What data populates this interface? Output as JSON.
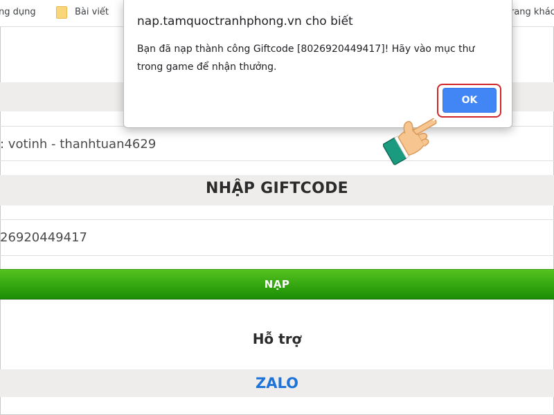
{
  "bookmarks": {
    "items": [
      {
        "label": "ng dụng"
      },
      {
        "label": "Bài viết"
      },
      {
        "label": "rang khác"
      }
    ]
  },
  "page": {
    "user_line": ": votinh - thanhtuan4629",
    "section_title": "NHẬP GIFTCODE",
    "code_value": "26920449417",
    "nap_button": "NẠP",
    "support_label": "Hỗ trợ",
    "zalo_link": "ZALO"
  },
  "dialog": {
    "title": "nap.tamquoctranhphong.vn cho biết",
    "message": "Bạn đã nạp thành công Giftcode [8026920449417]! Hãy vào mục thư trong game để nhận thưởng.",
    "ok_label": "OK"
  },
  "colors": {
    "ok_button": "#4285f4",
    "highlight_ring": "#d0262a",
    "nap_green": "#2ea70f",
    "zalo_blue": "#1e73d8"
  }
}
